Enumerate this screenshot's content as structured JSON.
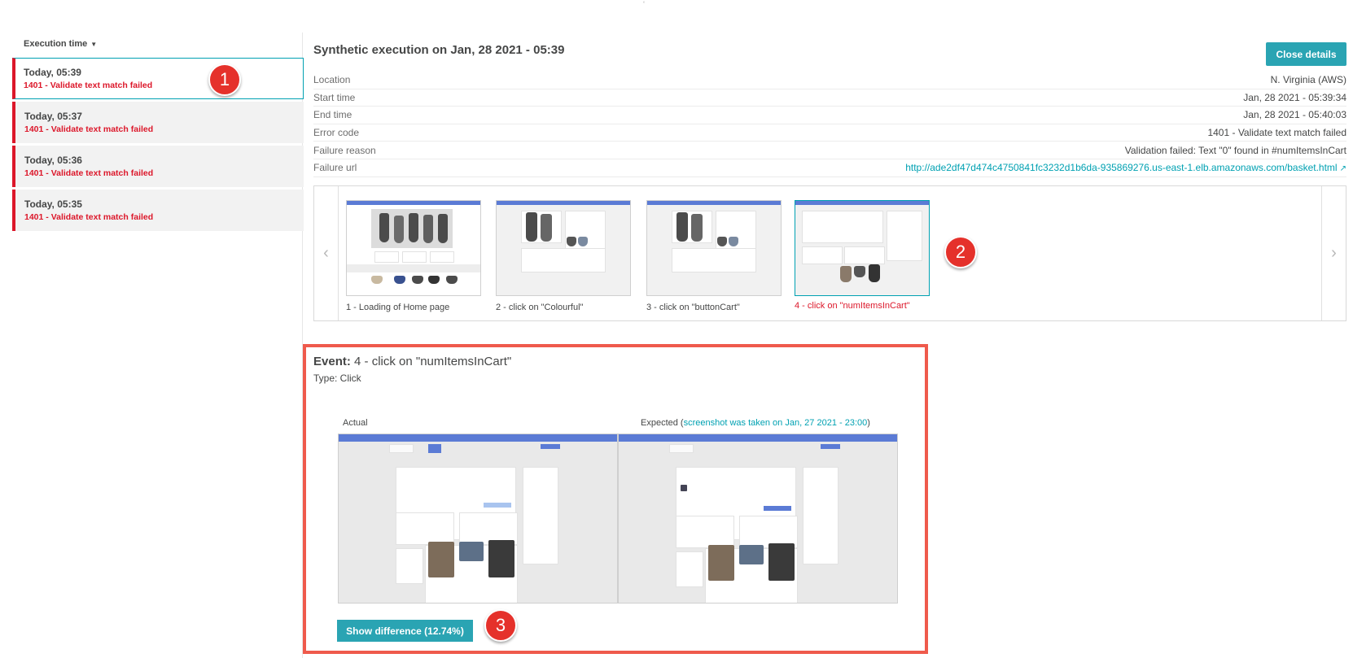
{
  "left": {
    "sort_label": "Execution time",
    "executions": [
      {
        "time": "Today, 05:39",
        "error": "1401 - Validate text match failed",
        "selected": true
      },
      {
        "time": "Today, 05:37",
        "error": "1401 - Validate text match failed",
        "selected": false
      },
      {
        "time": "Today, 05:36",
        "error": "1401 - Validate text match failed",
        "selected": false
      },
      {
        "time": "Today, 05:35",
        "error": "1401 - Validate text match failed",
        "selected": false
      }
    ]
  },
  "badges": [
    "1",
    "2",
    "3"
  ],
  "details": {
    "title": "Synthetic execution on Jan, 28 2021 - 05:39",
    "close_label": "Close details",
    "rows": [
      {
        "key": "Location",
        "value": "N. Virginia (AWS)"
      },
      {
        "key": "Start time",
        "value": "Jan, 28 2021 - 05:39:34"
      },
      {
        "key": "End time",
        "value": "Jan, 28 2021 - 05:40:03"
      },
      {
        "key": "Error code",
        "value": "1401 - Validate text match failed"
      },
      {
        "key": "Failure reason",
        "value": "Validation failed: Text \"0\" found in #numItemsInCart"
      },
      {
        "key": "Failure url",
        "value": "http://ade2df47d474c4750841fc3232d1b6da-935869276.us-east-1.elb.amazonaws.com/basket.html"
      }
    ]
  },
  "carousel": {
    "steps": [
      {
        "caption": "1 - Loading of Home page",
        "selected": false
      },
      {
        "caption": "2 - click on \"Colourful\"",
        "selected": false
      },
      {
        "caption": "3 - click on \"buttonCart\"",
        "selected": false
      },
      {
        "caption": "4 - click on \"numItemsInCart\"",
        "selected": true
      }
    ],
    "prev_icon": "chevron-left-icon",
    "next_icon": "chevron-right-icon"
  },
  "event": {
    "label": "Event:",
    "name": "4 - click on \"numItemsInCart\"",
    "type": "Type: Click",
    "actual_label": "Actual",
    "expected_label": "Expected (",
    "expected_link": "screenshot was taken on Jan, 27 2021 - 23:00",
    "expected_close": ")",
    "diff_button": "Show difference (12.74%)"
  },
  "colors": {
    "accent": "#00a1b2",
    "error": "#dc172a",
    "button": "#2aa4b3",
    "highlight": "#ef5a4c"
  }
}
